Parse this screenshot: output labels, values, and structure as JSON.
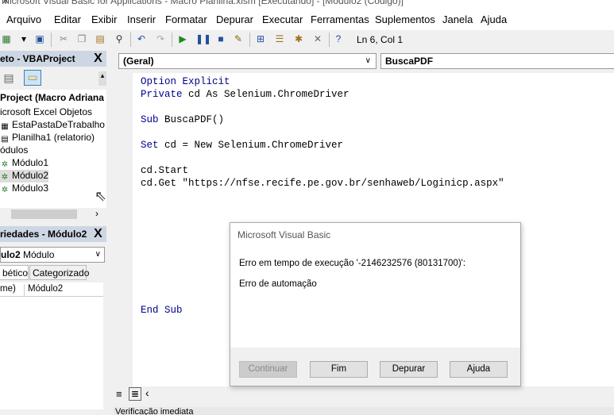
{
  "window": {
    "title": "Microsoft Visual Basic for Applications - Macro Planilha.xlsm [Executando] - [Módulo2 (Código)]",
    "close_glyph": "✕"
  },
  "menu": [
    "Arquivo",
    "Editar",
    "Exibir",
    "Inserir",
    "Formatar",
    "Depurar",
    "Executar",
    "Ferramentas",
    "Suplementos",
    "Janela",
    "Ajuda"
  ],
  "toolbar": {
    "position": "Ln 6, Col 1"
  },
  "project_pane": {
    "title": "eto - VBAProject",
    "close": "X",
    "tree": {
      "root": "Project (Macro Adriana",
      "folder1": "icrosoft Excel Objetos",
      "item1": "EstaPastaDeTrabalho",
      "item2": "Planilha1 (relatorio)",
      "folder2": "ódulos",
      "mod1": "Módulo1",
      "mod2": "Módulo2",
      "mod3": "Módulo3"
    }
  },
  "props_pane": {
    "title": "riedades - Módulo2",
    "close": "X",
    "combo_name": "ulo2",
    "combo_type": "Módulo",
    "tab_alpha": "bético",
    "tab_cat": "Categorizado",
    "row_key": "me)",
    "row_value": "Módulo2"
  },
  "code_window": {
    "object_combo": "(Geral)",
    "proc_combo": "BuscaPDF",
    "lines": [
      {
        "kw": "Option Explicit",
        "rest": ""
      },
      {
        "kw": "Private",
        "rest": " cd As Selenium.ChromeDriver"
      },
      {
        "kw": "",
        "rest": ""
      },
      {
        "kw": "Sub",
        "rest": " BuscaPDF()"
      },
      {
        "kw": "",
        "rest": ""
      },
      {
        "kw": "Set",
        "rest": " cd = New Selenium.ChromeDriver"
      },
      {
        "kw": "",
        "rest": ""
      },
      {
        "kw": "",
        "rest": "cd.Start"
      },
      {
        "kw": "",
        "rest": "cd.Get \"https://nfse.recife.pe.gov.br/senhaweb/Loginicp.aspx\""
      }
    ],
    "end_line": "End Sub"
  },
  "immediate_title": "Verificação imediata",
  "dialog": {
    "title": "Microsoft Visual Basic",
    "message1": "Erro em tempo de execução '-2146232576 (80131700)':",
    "message2": "Erro de automação",
    "buttons": {
      "continue": "Continuar",
      "end": "Fim",
      "debug": "Depurar",
      "help": "Ajuda"
    }
  },
  "colors": {
    "keyword": "#00008b",
    "pane_title": "#cdd6e3"
  }
}
